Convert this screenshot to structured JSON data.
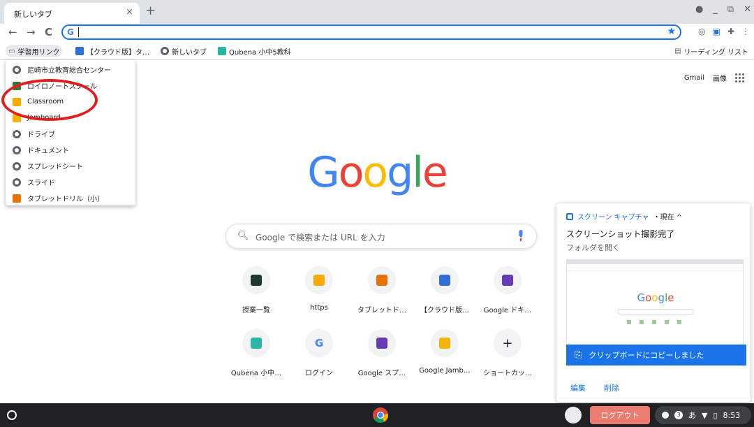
{
  "tab": {
    "title": "新しいタブ",
    "close": "×",
    "new": "+"
  },
  "window_controls": [
    "●",
    "_",
    "⧉",
    "✕"
  ],
  "toolbar": {
    "back": "←",
    "forward": "→",
    "reload": "C",
    "omnibox_value": "",
    "star": "★"
  },
  "bookmarks": {
    "folder": "学習用リンク",
    "items": [
      "【クラウド版】タ…",
      "新しいタブ",
      "Qubena 小中5教科"
    ],
    "reading_list": "リーディング リスト"
  },
  "dropdown": {
    "items": [
      {
        "label": "尼崎市立教育総合センター",
        "icon": "globe-icon"
      },
      {
        "label": "ロイロノートスクール",
        "icon": "loilo-icon"
      },
      {
        "label": "Classroom",
        "icon": "classroom-icon"
      },
      {
        "label": "Jamboard",
        "icon": "jamboard-icon"
      },
      {
        "label": "ドライブ",
        "icon": "globe-icon"
      },
      {
        "label": "ドキュメント",
        "icon": "globe-icon"
      },
      {
        "label": "スプレッドシート",
        "icon": "globe-icon"
      },
      {
        "label": "スライド",
        "icon": "globe-icon"
      },
      {
        "label": "タブレットドリル（小）",
        "icon": "drill-icon"
      }
    ]
  },
  "top_links": {
    "gmail": "Gmail",
    "images": "画像"
  },
  "logo": {
    "text": "Google"
  },
  "search": {
    "placeholder": "Google で検索または URL を入力"
  },
  "shortcuts": [
    {
      "label": "授業一覧"
    },
    {
      "label": "https"
    },
    {
      "label": "タブレットド…"
    },
    {
      "label": "【クラウド版…"
    },
    {
      "label": "Google ドキ…"
    },
    {
      "label": "Qubena 小中…"
    },
    {
      "label": "ログイン"
    },
    {
      "label": "Google スプ…"
    },
    {
      "label": "Google Jamb…"
    },
    {
      "label": "ショートカッ…"
    }
  ],
  "notification": {
    "header_app": "スクリーン キャプチャ",
    "header_time": "・現在 ^",
    "title": "スクリーンショット撮影完了",
    "subtitle": "フォルダを開く",
    "copied": "クリップボードにコピーしました",
    "edit": "編集",
    "delete": "削除"
  },
  "shelf": {
    "logout": "ログアウト",
    "ime": "あ",
    "time": "8:53",
    "badge": "3"
  },
  "colors": {
    "accent": "#1a73e8",
    "annotation": "#e21d1d",
    "logout": "#ec7b70"
  }
}
